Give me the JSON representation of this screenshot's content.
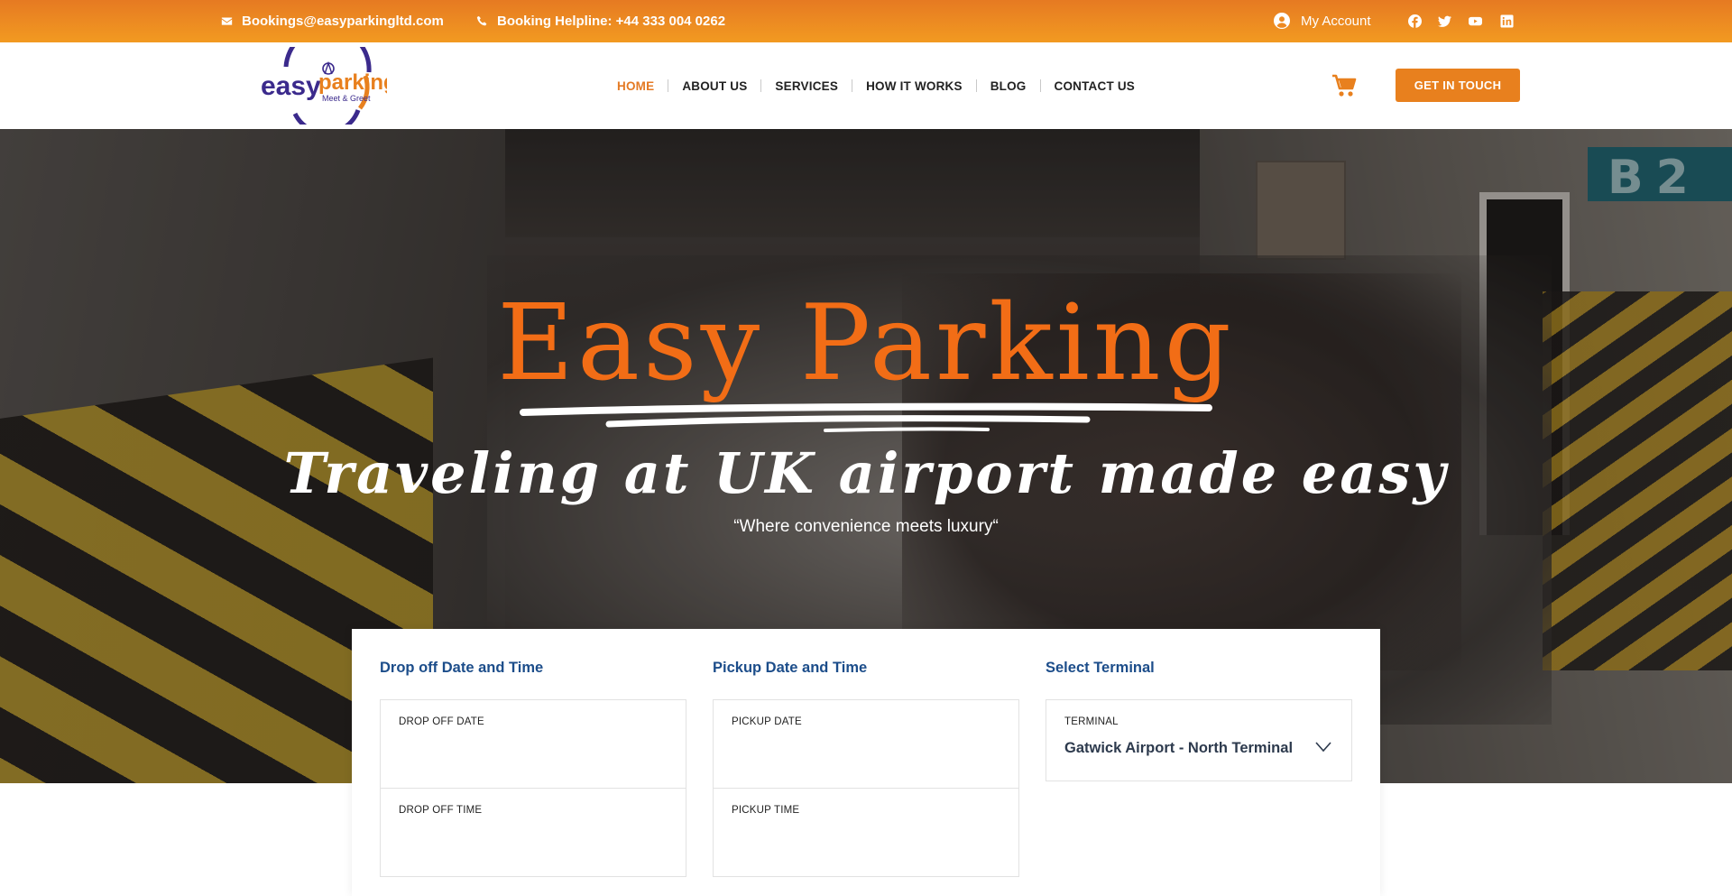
{
  "topbar": {
    "email": "Bookings@easyparkingltd.com",
    "helpline": "Booking Helpline: +44 333 004 0262",
    "account": "My Account",
    "socials": [
      "facebook-icon",
      "twitter-icon",
      "youtube-icon",
      "linkedin-icon"
    ]
  },
  "header": {
    "logo_main": "easy",
    "logo_accent": "parking",
    "logo_tagline": "Meet & Greet",
    "nav": [
      {
        "label": "HOME",
        "active": true
      },
      {
        "label": "ABOUT US"
      },
      {
        "label": "SERVICES"
      },
      {
        "label": "HOW IT WORKS"
      },
      {
        "label": "BLOG"
      },
      {
        "label": "CONTACT US"
      }
    ],
    "cta": "GET IN TOUCH"
  },
  "hero": {
    "title": "Easy Parking",
    "subtitle": "Traveling at UK airport made easy",
    "quote": "“Where convenience meets luxury“",
    "sign_text": "B2"
  },
  "booking": {
    "dropoff": {
      "heading": "Drop off Date and Time",
      "date_label": "DROP OFF DATE",
      "time_label": "DROP OFF TIME"
    },
    "pickup": {
      "heading": "Pickup Date and Time",
      "date_label": "PICKUP DATE",
      "time_label": "PICKUP TIME"
    },
    "terminal": {
      "heading": "Select Terminal",
      "label": "TERMINAL",
      "value": "Gatwick Airport - North Terminal"
    }
  },
  "colors": {
    "accent": "#e8801e",
    "title_orange": "#f26d16",
    "heading_blue": "#1c4d8a",
    "logo_purple": "#3b2a8c"
  }
}
